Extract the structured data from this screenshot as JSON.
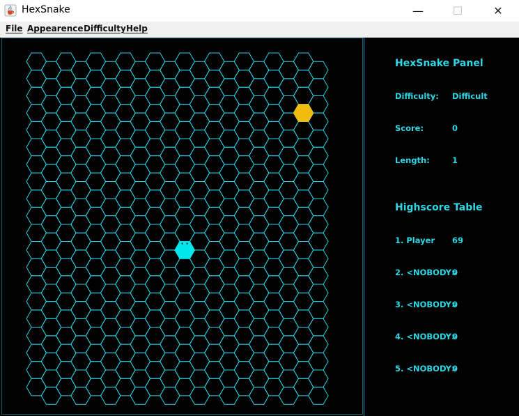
{
  "window": {
    "title": "HexSnake",
    "app_icon": "java-cup-icon",
    "controls": {
      "minimize": "—",
      "maximize": "☐",
      "close": "✕"
    }
  },
  "menu": {
    "items": [
      "File",
      "Appearence",
      "Difficulty",
      "Help"
    ]
  },
  "board": {
    "columns": 20,
    "rows": 20,
    "grid_color": "#27d3e6",
    "snake_head": {
      "col": 10,
      "row": 11,
      "color": "#00e7f0"
    },
    "food": {
      "col": 18,
      "row": 3,
      "color": "#f0bd0e"
    }
  },
  "panel": {
    "title": "HexSnake Panel",
    "difficulty_label": "Difficulty:",
    "difficulty_value": "Difficult",
    "score_label": "Score:",
    "score_value": "0",
    "length_label": "Length:",
    "length_value": "1",
    "highscore_title": "Highscore Table",
    "highscores": [
      {
        "rank_name": "1. Player",
        "score": "69"
      },
      {
        "rank_name": "2. <NOBODY>",
        "score": "0"
      },
      {
        "rank_name": "3. <NOBODY>",
        "score": "0"
      },
      {
        "rank_name": "4. <NOBODY>",
        "score": "0"
      },
      {
        "rank_name": "5. <NOBODY>",
        "score": "0"
      }
    ],
    "text_color": "#2ed7e6"
  }
}
